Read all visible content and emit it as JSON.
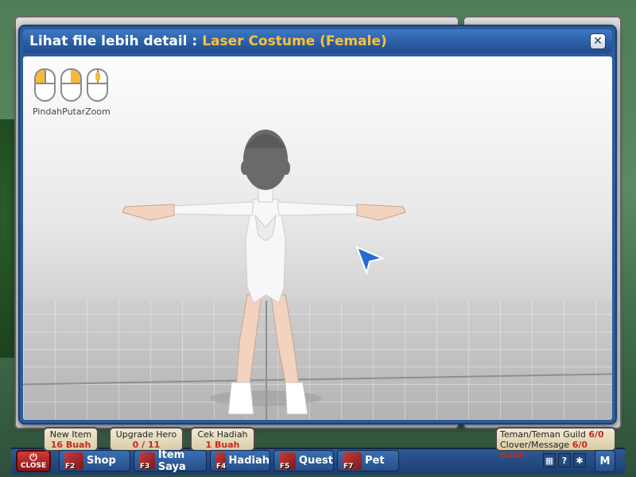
{
  "modal": {
    "title_prefix": "Lihat file lebih detail :",
    "item_name": "Laser Costume (Female)",
    "close_label": "✕"
  },
  "controls": [
    {
      "label": "Pindah",
      "highlight": "left"
    },
    {
      "label": "Putar",
      "highlight": "right"
    },
    {
      "label": "Zoom",
      "highlight": "wheel"
    }
  ],
  "hud": {
    "close_label": "CLOSE",
    "badges": [
      {
        "title": "New Item",
        "value": "16 Buah"
      },
      {
        "title": "Upgrade Hero",
        "value": "0 / 11"
      },
      {
        "title": "Cek Hadiah",
        "value": "1 Buah"
      }
    ],
    "menu": [
      {
        "label": "Shop",
        "key": "F2",
        "icon": "shop-icon"
      },
      {
        "label": "Item Saya",
        "key": "F3",
        "icon": "bag-icon"
      },
      {
        "label": "Hadiah",
        "key": "F4",
        "icon": "gift-icon"
      },
      {
        "label": "Quest",
        "key": "F5",
        "icon": "quest-icon"
      },
      {
        "label": "Pet",
        "key": "F7",
        "icon": "pet-icon"
      }
    ],
    "info": {
      "friends_label": "Teman/Teman Guild",
      "friends_value": "6/0",
      "message_label": "Clover/Message",
      "message_value": "6/0 buah"
    },
    "small_icons": [
      "grid-icon",
      "help-icon",
      "settings-icon"
    ],
    "m_label": "M"
  },
  "colors": {
    "title_accent": "#ffc233",
    "badge_value": "#c62a1a",
    "frame_blue": "#2b5c9b"
  }
}
